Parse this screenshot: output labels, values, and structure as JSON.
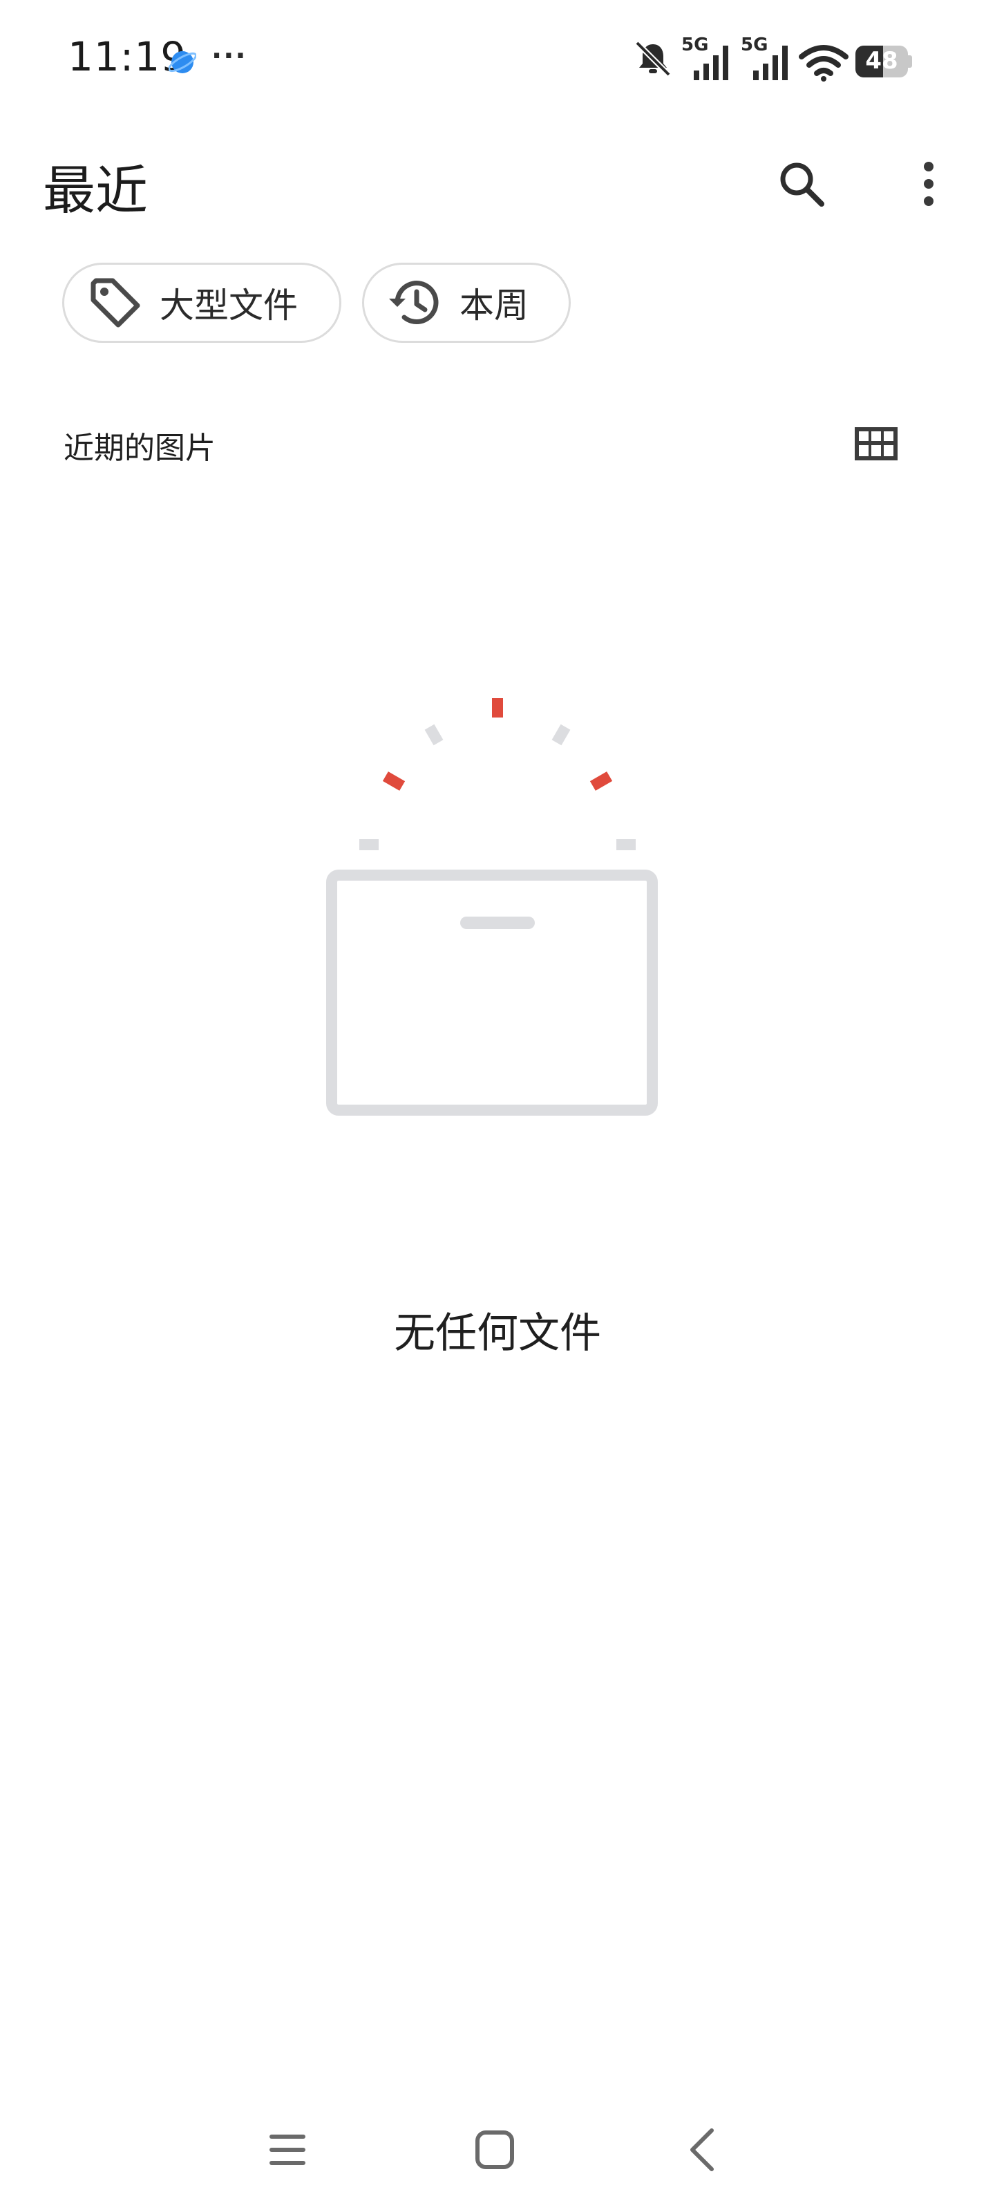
{
  "status_bar": {
    "time": "11:19",
    "more": "···",
    "network_1": "5G",
    "network_2": "5G",
    "battery": "48"
  },
  "header": {
    "title": "最近"
  },
  "chips": [
    {
      "label": "大型文件",
      "icon": "tag-icon"
    },
    {
      "label": "本周",
      "icon": "history-icon"
    }
  ],
  "section": {
    "title": "近期的图片"
  },
  "empty_state": {
    "message": "无任何文件"
  },
  "colors": {
    "accent_red": "#e04a3c",
    "illustration_gray": "#dcdde0",
    "chip_border": "#dcdcdc",
    "icon_dark": "#3c3c3c"
  }
}
